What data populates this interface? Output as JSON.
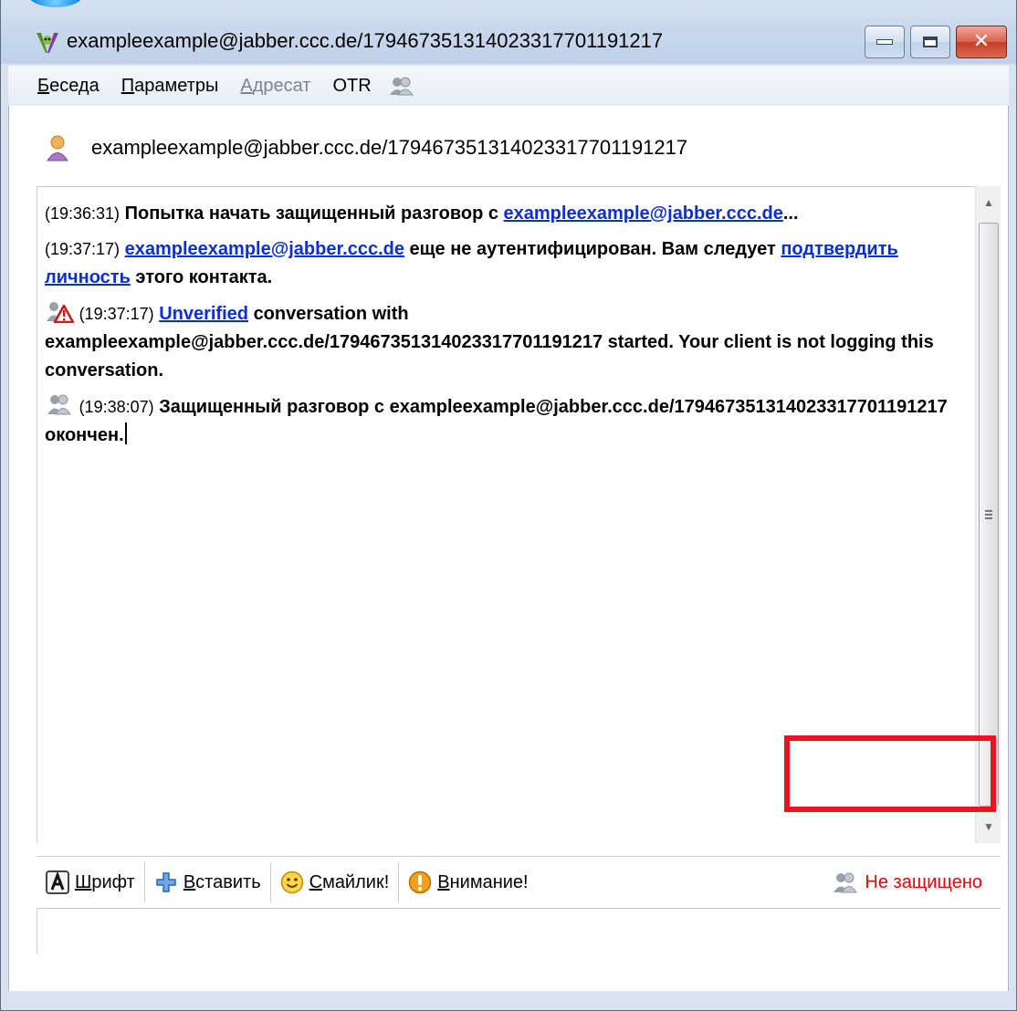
{
  "window": {
    "title": "exampleexample@jabber.ccc.de/179467351314023317701191217",
    "colors": {
      "frame": "#d8e3f1",
      "link": "#0b2fd6",
      "status_red": "#ee0000",
      "highlight": "#e8141e"
    }
  },
  "menubar": {
    "items": [
      {
        "ul": "Б",
        "rest": "еседа",
        "enabled": true
      },
      {
        "ul": "П",
        "rest": "араметры",
        "enabled": true
      },
      {
        "ul": "А",
        "rest": "дресат",
        "enabled": false
      },
      {
        "ul": "",
        "rest": "OTR",
        "enabled": true
      }
    ],
    "otr_icon": "otr-buddies-icon"
  },
  "contact": {
    "name": "exampleexample@jabber.ccc.de/179467351314023317701191217",
    "icon": "buddy-person-icon"
  },
  "messages": [
    {
      "time": "(19:36:31)",
      "text": "Попытка начать защищенный разговор с",
      "link": "exampleexample@jabber.ccc.de",
      "tail": "..."
    },
    {
      "time": "(19:37:17)",
      "link": "exampleexample@jabber.ccc.de",
      "text": "еще не аутентифицирован. Вам следует",
      "link2": "подтвердить личность",
      "tail": "этого контакта."
    },
    {
      "icon": "otr-unverified-warning-icon",
      "time": "(19:37:17)",
      "link": "Unverified",
      "text": "conversation with exampleexample@jabber.ccc.de/179467351314023317701191217 started.  Your client is not logging this conversation."
    },
    {
      "icon": "otr-not-private-icon",
      "time": "(19:38:07)",
      "text": "Защищенный разговор с exampleexample@jabber.ccc.de/179467351314023317701191217 окончен."
    }
  ],
  "toolbar": {
    "font": {
      "ul": "Ш",
      "rest": "рифт"
    },
    "insert": {
      "ul": "В",
      "rest": "ставить"
    },
    "smiley": {
      "ul": "С",
      "rest": "майлик!"
    },
    "attention": {
      "ul": "В",
      "rest": "нимание!"
    },
    "status": "Не защищено"
  }
}
